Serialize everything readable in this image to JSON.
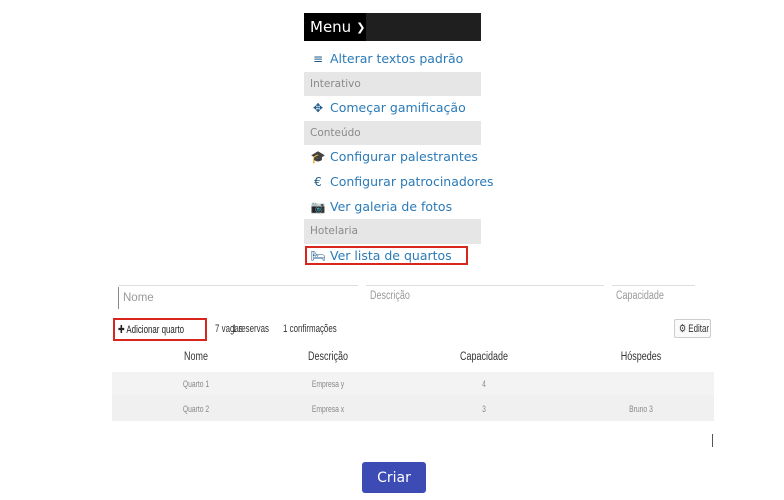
{
  "menu": {
    "label": "Menu",
    "items": [
      {
        "type": "item",
        "icon": "align-left-icon",
        "glyph": "≡",
        "label": "Alterar textos padrão"
      },
      {
        "type": "header",
        "label": "Interativo"
      },
      {
        "type": "item",
        "icon": "crosshair-icon",
        "glyph": "✥",
        "label": "Começar gamificação"
      },
      {
        "type": "header",
        "label": "Conteúdo"
      },
      {
        "type": "item",
        "icon": "graduation-cap-icon",
        "glyph": "🎓",
        "label": "Configurar palestrantes"
      },
      {
        "type": "item",
        "icon": "euro-icon",
        "glyph": "€",
        "label": "Configurar patrocinadores"
      },
      {
        "type": "item",
        "icon": "camera-icon",
        "glyph": "📷",
        "label": "Ver galeria de fotos"
      },
      {
        "type": "header",
        "label": "Hotelaria"
      },
      {
        "type": "item",
        "icon": "bed-icon",
        "glyph": "🛏",
        "label": "Ver lista de quartos"
      }
    ]
  },
  "form": {
    "name_placeholder": "Nome",
    "description_label": "Descrição",
    "capacity_label": "Capacidade"
  },
  "toolbar": {
    "add_label": "✚ Adicionar quarto",
    "vagas": "7 vagas",
    "reservas": "1 reservas",
    "confirmacoes": "1 confirmações",
    "edit_label": "⚙ Editar"
  },
  "table": {
    "headers": [
      "Nome",
      "Descrição",
      "Capacidade",
      "Hóspedes"
    ],
    "rows": [
      [
        "Quarto 1",
        "Empresa y",
        "4",
        ""
      ],
      [
        "Quarto 2",
        "Empresa x",
        "3",
        "Bruno 3"
      ]
    ]
  },
  "create_label": "Criar",
  "colors": {
    "accent": "#3d4bb5",
    "highlight": "#d8261c",
    "link": "#2a7ab8"
  }
}
